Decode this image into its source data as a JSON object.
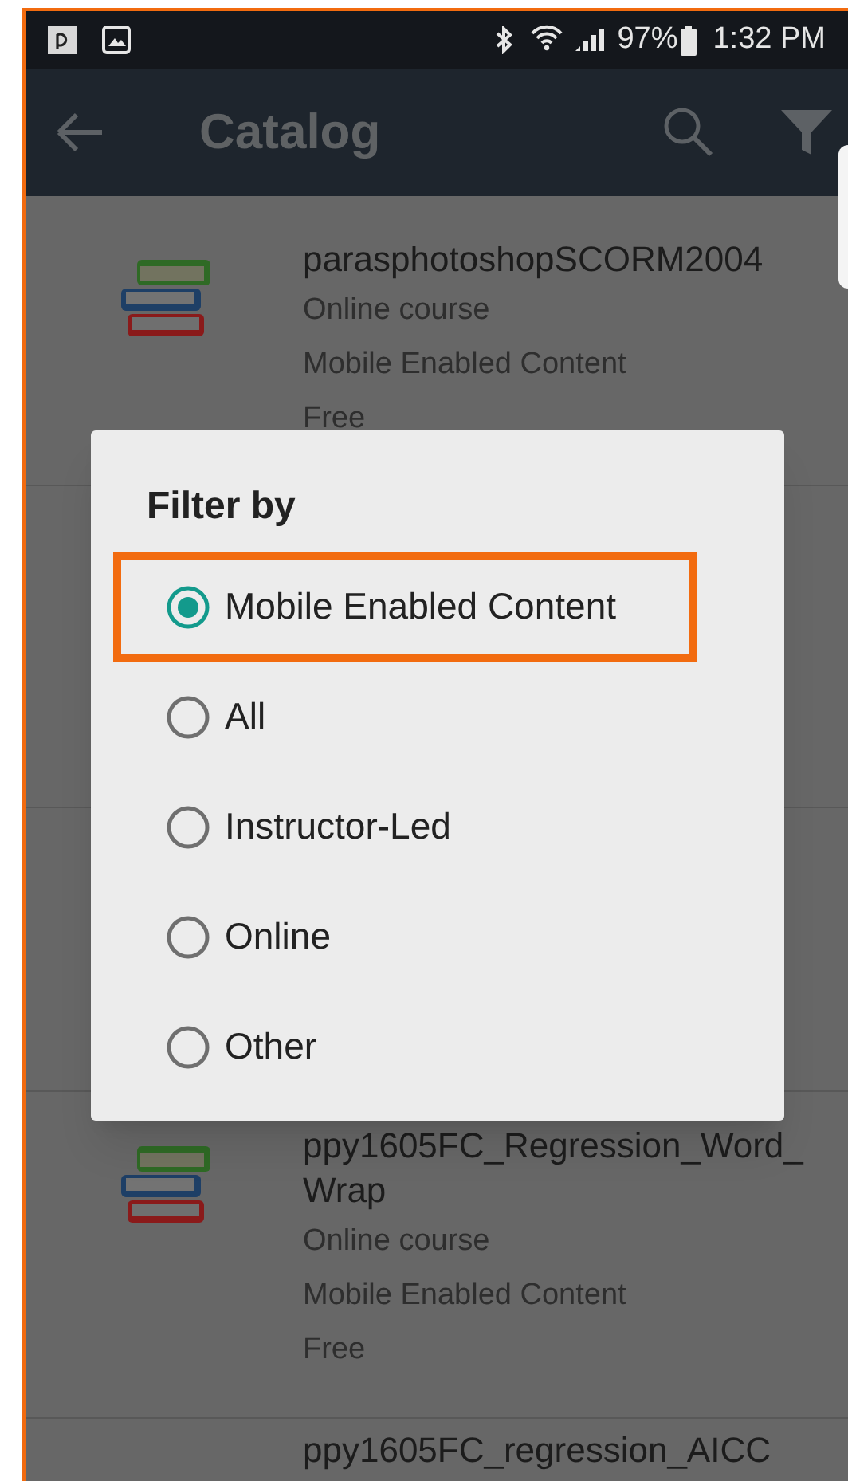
{
  "status_bar": {
    "battery": "97%",
    "time": "1:32 PM"
  },
  "app_bar": {
    "title": "Catalog"
  },
  "catalog_items": [
    {
      "title": "parasphotoshopSCORM2004",
      "type": "Online course",
      "platform": "Mobile Enabled Content",
      "price": "Free"
    },
    {
      "title": "ppy1605FC_Regression_Word_ Wrap",
      "type": "Online course",
      "platform": "Mobile Enabled Content",
      "price": "Free"
    },
    {
      "title": "ppy1605FC_regression_AICC"
    }
  ],
  "filter_dialog": {
    "title": "Filter by",
    "options": [
      {
        "label": "Mobile Enabled Content",
        "selected": true,
        "highlighted": true
      },
      {
        "label": "All",
        "selected": false,
        "highlighted": false
      },
      {
        "label": "Instructor-Led",
        "selected": false,
        "highlighted": false
      },
      {
        "label": "Online",
        "selected": false,
        "highlighted": false
      },
      {
        "label": "Other",
        "selected": false,
        "highlighted": false
      }
    ]
  }
}
